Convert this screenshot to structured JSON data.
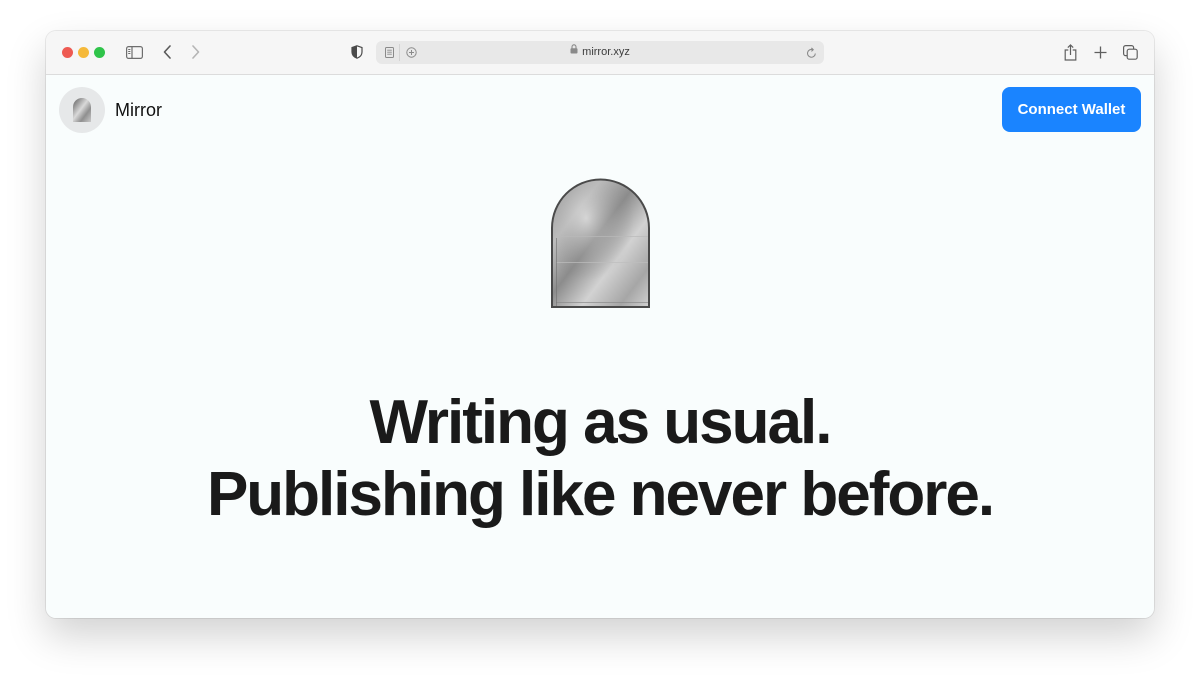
{
  "browser": {
    "url": "mirror.xyz",
    "icons": {
      "close": "traffic-light-close",
      "minimize": "traffic-light-minimize",
      "maximize": "traffic-light-maximize",
      "sidebar": "sidebar-icon",
      "back": "chevron-left-icon",
      "forward": "chevron-right-icon",
      "privacy": "shield-icon",
      "reader": "reader-icon",
      "extension": "plus-circle-icon",
      "lock": "lock-icon",
      "reload": "reload-icon",
      "share": "share-icon",
      "new_tab": "plus-icon",
      "tabs": "tabs-overview-icon"
    }
  },
  "header": {
    "brand_name": "Mirror",
    "connect_label": "Connect Wallet",
    "accent_color": "#1a84ff"
  },
  "hero": {
    "line1": "Writing as usual.",
    "line2": "Publishing like never before."
  }
}
